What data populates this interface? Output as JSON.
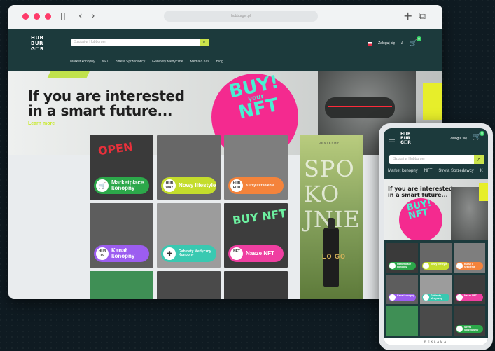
{
  "browser": {
    "url": "hubburger.pl",
    "icons": [
      "sidebar-icon",
      "back-icon",
      "forward-icon",
      "new-tab-icon",
      "tabs-icon"
    ]
  },
  "brand": {
    "logo_line1": "HUB",
    "logo_line2": "BUR",
    "logo_line3": "G☐R",
    "accent": "#cbe44b",
    "header_bg": "#1c3a3c",
    "magenta": "#f42a8f"
  },
  "desktop": {
    "search_placeholder": "Szukaj w Hubburger",
    "nav": [
      "Market konopny",
      "NFT",
      "Strefa Sprzedawcy",
      "Gabinety Medyczne",
      "Media o nas",
      "Blog"
    ],
    "login": "Zaloguj się",
    "cart_count": "0",
    "hero": {
      "title_line1": "If you are interested",
      "title_line2": "in a smart future...",
      "cta": "Learn more",
      "badge_line1": "BUY!",
      "badge_line2": "your",
      "badge_line3": "NFT"
    },
    "tiles": [
      {
        "label": "Marketplace konopny",
        "icon": "cart-icon",
        "color": "#2ca84a",
        "bg": "#3a3a3a",
        "art": "OPEN"
      },
      {
        "label": "Nowy lifestyle",
        "icon": "HUB WAY",
        "color": "#c4dd2c",
        "bg": "#676767",
        "art": ""
      },
      {
        "label": "Kursy i szkolenia",
        "icon": "HUB EDU",
        "color": "#f4833b",
        "bg": "#7e7e7e",
        "art": ""
      },
      {
        "label": "Kanał konopny",
        "icon": "HUB TV",
        "color": "#9c5df0",
        "bg": "#5d5d5d",
        "art": ""
      },
      {
        "label": "Gabinety Medyczny Konopny",
        "icon": "plus-icon",
        "color": "#39c9b1",
        "bg": "#9c9c9c",
        "art": ""
      },
      {
        "label": "Nasze NFT",
        "icon": "NFT",
        "color": "#ef3fa1",
        "bg": "#3d3d3d",
        "art": "BUY NFT"
      },
      {
        "label": "",
        "icon": "",
        "color": "",
        "bg": "#3f8f55",
        "art": ""
      },
      {
        "label": "",
        "icon": "",
        "color": "",
        "bg": "#4a4a4a",
        "art": ""
      },
      {
        "label": "",
        "icon": "",
        "color": "",
        "bg": "#3c3c3c",
        "art": ""
      }
    ],
    "promo": {
      "top_text": "JESTEŚMY",
      "word": "SPO\nKO\nJNIE",
      "bottle_label": "LO GO"
    }
  },
  "mobile": {
    "login": "Zaloguj się",
    "cart_count": "0",
    "search_placeholder": "Szukaj w Hubburger",
    "nav": [
      "Market konopny",
      "NFT",
      "Strefa Sprzedawcy",
      "K"
    ],
    "hero_line1": "If you are interested",
    "hero_line2": "in a smart future...",
    "badge_line1": "BUY!",
    "badge_line2": "NFT",
    "tiles": [
      {
        "label": "Marketplace konopny",
        "color": "#2ca84a",
        "bg": "#3a3a3a"
      },
      {
        "label": "Nowy lifestyle",
        "color": "#c4dd2c",
        "bg": "#676767"
      },
      {
        "label": "Kursy i szkolenia",
        "color": "#f4833b",
        "bg": "#7e7e7e"
      },
      {
        "label": "Kanał konopny",
        "color": "#9c5df0",
        "bg": "#5d5d5d"
      },
      {
        "label": "Gabinety Medyczny",
        "color": "#39c9b1",
        "bg": "#9c9c9c"
      },
      {
        "label": "Nasze NFT",
        "color": "#ef3fa1",
        "bg": "#3d3d3d"
      },
      {
        "label": "",
        "color": "",
        "bg": "#3f8f55"
      },
      {
        "label": "",
        "color": "",
        "bg": "#4a4a4a"
      },
      {
        "label": "Strefa Sprzedawcy",
        "color": "#2ca84a",
        "bg": "#3c3c3c"
      }
    ],
    "footer": "REKLAMA"
  }
}
